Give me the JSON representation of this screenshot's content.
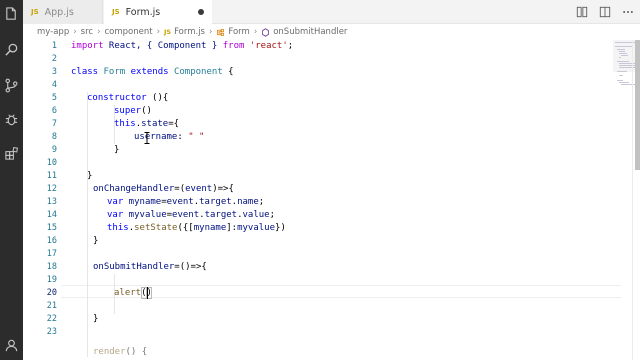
{
  "tabs": [
    {
      "badge": "JS",
      "label": "App.js"
    },
    {
      "badge": "JS",
      "label": "Form.js"
    }
  ],
  "activity_icons": [
    "files-icon",
    "search-icon",
    "source-control-icon",
    "debug-icon",
    "extensions-icon",
    "account-icon"
  ],
  "breadcrumb": {
    "items": [
      "my-app",
      "src",
      "component"
    ],
    "file_badge": "JS",
    "file": "Form.js",
    "class_name": "Form",
    "method": "onSubmitHandler"
  },
  "line_numbers": [
    "1",
    "2",
    "3",
    "4",
    "5",
    "6",
    "7",
    "8",
    "9",
    "10",
    "11",
    "12",
    "13",
    "14",
    "15",
    "16",
    "17",
    "18",
    "19",
    "20",
    "21",
    "22",
    "23"
  ],
  "code": {
    "l1": {
      "kw": "import",
      "a": " React, { Component } ",
      "kw2": "from",
      "str": " 'react'",
      "end": ";"
    },
    "l3": {
      "kw": "class",
      "cls": " Form ",
      "kw2": "extends",
      "cls2": " Component",
      "end": " {"
    },
    "l5": {
      "kw": "constructor",
      "end": " (){"
    },
    "l6": {
      "fn": "super",
      "end": "()"
    },
    "l7": {
      "kw": "this",
      "a": ".",
      "var": "state",
      "end": "={"
    },
    "l8": {
      "var": "username",
      "a": ": ",
      "str": "\" \""
    },
    "l9": {
      "end": "}"
    },
    "l11": {
      "end": "}"
    },
    "l12": {
      "fn": "onChangeHandler",
      "a": "=(",
      "var": "event",
      "end": ")=>{"
    },
    "l13": {
      "kw": "var",
      "var": " myname",
      "a": "=",
      "v2": "event",
      "b": ".",
      "v3": "target",
      "c": ".",
      "v4": "name",
      "end": ";"
    },
    "l14": {
      "kw": "var",
      "var": " myvalue",
      "a": "=",
      "v2": "event",
      "b": ".",
      "v3": "target",
      "c": ".",
      "v4": "value",
      "end": ";"
    },
    "l15": {
      "kw": "this",
      "a": ".",
      "fn": "setState",
      "b": "({[",
      "var": "myname",
      "c": "]:",
      "v2": "myvalue",
      "end": "})"
    },
    "l16": {
      "end": "}"
    },
    "l18": {
      "fn": "onSubmitHandler",
      "end": "=()=>{"
    },
    "l20": {
      "fn": "alert",
      "end": "()"
    },
    "l22": {
      "end": "}"
    },
    "l24": {
      "fn": "render",
      "end": "() {"
    }
  },
  "colors": {
    "activity_bar": "#2c2c2c",
    "keyword": "#0000ff",
    "string": "#a31515",
    "class": "#267f99",
    "function": "#795e26",
    "variable": "#001080",
    "line_number": "#237893"
  }
}
